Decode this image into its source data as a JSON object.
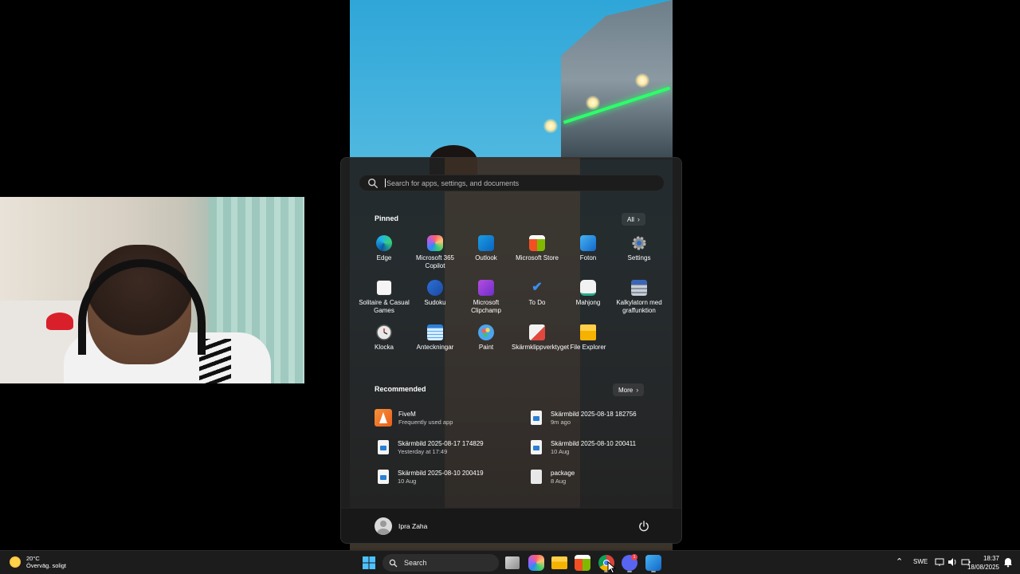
{
  "start_menu": {
    "search_placeholder": "Search for apps, settings, and documents",
    "pinned_title": "Pinned",
    "all_label": "All",
    "pinned": [
      {
        "label": "Edge",
        "icon": "edge-icon"
      },
      {
        "label": "Microsoft 365 Copilot",
        "icon": "m365-copilot-icon"
      },
      {
        "label": "Outlook",
        "icon": "outlook-icon"
      },
      {
        "label": "Microsoft Store",
        "icon": "store-icon"
      },
      {
        "label": "Foton",
        "icon": "photos-icon"
      },
      {
        "label": "Settings",
        "icon": "gear-icon"
      },
      {
        "label": "Solitaire & Casual Games",
        "icon": "solitaire-icon"
      },
      {
        "label": "Sudoku",
        "icon": "sudoku-icon"
      },
      {
        "label": "Microsoft Clipchamp",
        "icon": "clipchamp-icon"
      },
      {
        "label": "To Do",
        "icon": "todo-icon"
      },
      {
        "label": "Mahjong",
        "icon": "mahjong-icon"
      },
      {
        "label": "Kalkylatorn med graffunktion",
        "icon": "calculator-icon"
      },
      {
        "label": "Klocka",
        "icon": "clock-icon"
      },
      {
        "label": "Anteckningar",
        "icon": "notepad-icon"
      },
      {
        "label": "Paint",
        "icon": "paint-icon"
      },
      {
        "label": "Skärmklippverktyget",
        "icon": "snipping-tool-icon"
      },
      {
        "label": "File Explorer",
        "icon": "folder-icon"
      }
    ],
    "recommended_title": "Recommended",
    "more_label": "More",
    "recommended": [
      {
        "title": "FiveM",
        "subtitle": "Frequently used app",
        "icon": "fivem-icon"
      },
      {
        "title": "Skärmbild 2025-08-18 182756",
        "subtitle": "9m ago",
        "icon": "image-file-icon"
      },
      {
        "title": "Skärmbild 2025-08-17 174829",
        "subtitle": "Yesterday at 17:49",
        "icon": "image-file-icon"
      },
      {
        "title": "Skärmbild 2025-08-10 200411",
        "subtitle": "10 Aug",
        "icon": "image-file-icon"
      },
      {
        "title": "Skärmbild 2025-08-10 200419",
        "subtitle": "10 Aug",
        "icon": "image-file-icon"
      },
      {
        "title": "package",
        "subtitle": "8 Aug",
        "icon": "file-icon"
      }
    ],
    "user_name": "Ipra Zaha"
  },
  "taskbar": {
    "weather_temp": "20°C",
    "weather_desc": "Överväg. soligt",
    "search_label": "Search",
    "language": "SWE",
    "time": "18:37",
    "date": "18/08/2025",
    "discord_badge": "1"
  },
  "colors": {
    "menu_bg": "#202020",
    "taskbar_bg": "#1c1c1c",
    "accent": "#0078d4"
  }
}
